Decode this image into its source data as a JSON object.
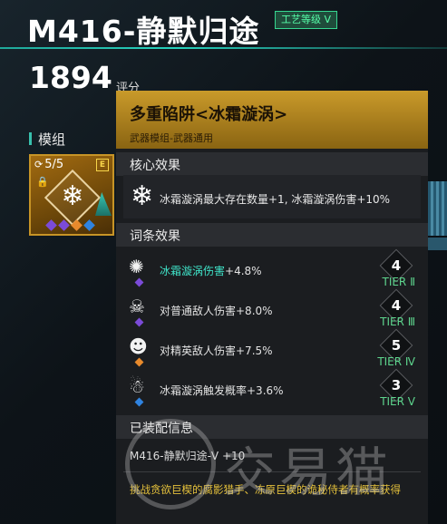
{
  "weapon": {
    "name": "M416-静默归途",
    "craft_badge": "工艺等级 V",
    "score": "1894",
    "score_label": "评分"
  },
  "module_section": {
    "label": "模组",
    "card": {
      "count": "5/5",
      "tag": "E",
      "dot_colors": [
        "#7b4bd8",
        "#7b4bd8",
        "#e88a2c",
        "#2f83e0"
      ]
    }
  },
  "panel": {
    "title": "多重陷阱<冰霜漩涡>",
    "subtitle": "武器模组-武器通用",
    "core_header": "核心效果",
    "core_effect": "冰霜漩涡最大存在数量+1, 冰霜漩涡伤害+10%",
    "affix_header": "词条效果",
    "affixes": [
      {
        "highlight": "冰霜漩涡伤害",
        "text": "+4.8%",
        "tier_num": "4",
        "tier_label": "TIER Ⅱ",
        "icon": "frost-burst-icon",
        "gem_color": "#7b4bd8"
      },
      {
        "highlight": "",
        "text": "对普通敌人伤害+8.0%",
        "tier_num": "4",
        "tier_label": "TIER Ⅲ",
        "icon": "flame-skull-icon",
        "gem_color": "#7b4bd8"
      },
      {
        "highlight": "",
        "text": "对精英敌人伤害+7.5%",
        "tier_num": "5",
        "tier_label": "TIER Ⅳ",
        "icon": "elite-skull-icon",
        "gem_color": "#e88a2c"
      },
      {
        "highlight": "",
        "text": "冰霜漩涡触发概率+3.6%",
        "tier_num": "3",
        "tier_label": "TIER Ⅴ",
        "icon": "frost-skull-icon",
        "gem_color": "#2f83e0"
      }
    ],
    "equip_header": "已装配信息",
    "equip_info": "M416-静默归途-Ⅴ +10",
    "hunt_info": "挑战贪欲巨楔的腐影猎手、冻原巨楔的诡秘侍者有概率获得"
  },
  "watermark": "交易猫",
  "colors": {
    "accent_teal": "#27d1bd",
    "gold": "#c99a2a",
    "tier_green": "#5ed68e",
    "highlight_cyan": "#3fe4c9",
    "hunt_yellow": "#e5c13b"
  }
}
